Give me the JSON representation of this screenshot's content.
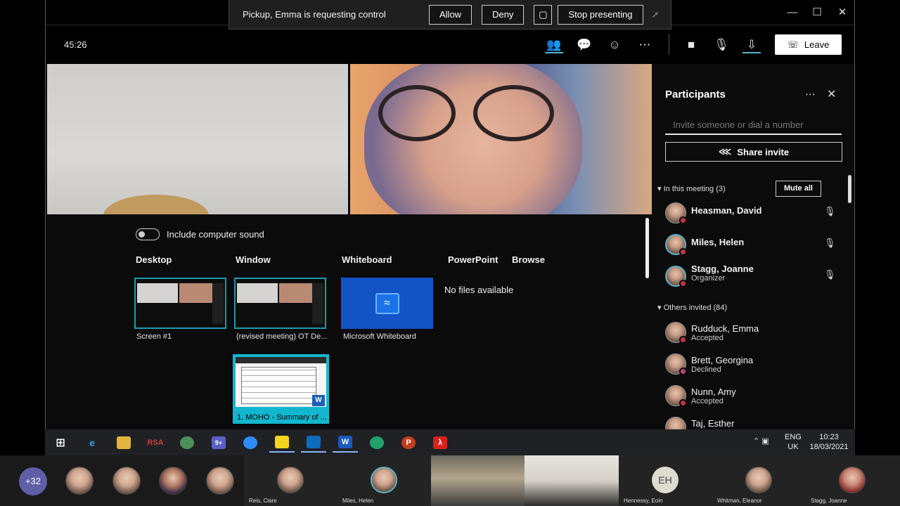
{
  "control_request": {
    "message": "Pickup, Emma is requesting control",
    "allow_label": "Allow",
    "deny_label": "Deny",
    "stop_presenting_label": "Stop presenting"
  },
  "meeting": {
    "timer": "45:26",
    "leave_label": "Leave"
  },
  "share_tray": {
    "include_sound_label": "Include computer sound",
    "categories": [
      "Desktop",
      "Window",
      "Whiteboard",
      "PowerPoint",
      "Browse"
    ],
    "desktop_thumb_caption": "Screen #1",
    "window_thumb_caption": "(revised meeting) OT De...",
    "whiteboard_caption": "Microsoft Whiteboard",
    "no_files_text": "No files available",
    "doc_thumb_caption": "1. MOHO - Summary of ..."
  },
  "participants": {
    "title": "Participants",
    "invite_placeholder": "Invite someone or dial a number",
    "share_invite_label": "Share invite",
    "in_meeting_label": "In this meeting (3)",
    "mute_all_label": "Mute all",
    "in_meeting": [
      {
        "name": "Heasman, David",
        "role": ""
      },
      {
        "name": "Miles, Helen",
        "role": ""
      },
      {
        "name": "Stagg, Joanne",
        "role": "Organizer"
      }
    ],
    "others_label": "Others invited (84)",
    "others": [
      {
        "name": "Rudduck, Emma",
        "status": "Accepted"
      },
      {
        "name": "Brett, Georgina",
        "status": "Declined"
      },
      {
        "name": "Nunn, Amy",
        "status": "Accepted"
      },
      {
        "name": "Taj, Esther",
        "status": ""
      }
    ]
  },
  "taskbar": {
    "rsa_label": "RSA",
    "teams_badge": "9+",
    "lang_line1": "ENG",
    "lang_line2": "UK",
    "time": "10:23",
    "date": "18/03/2021"
  },
  "gallery": {
    "overflow_count": "+32",
    "tiles": [
      {
        "name": "Reis, Clare"
      },
      {
        "name": "Miles, Helen"
      },
      {
        "name": "Hennessy, Eoin",
        "initials": "EH"
      },
      {
        "name": "Whitman, Eleanor"
      },
      {
        "name": "Stagg, Joanne"
      }
    ]
  },
  "colors": {
    "accent": "#5ab4c8",
    "whiteboard": "#1253c6",
    "presence_busy": "#c4314b",
    "overflow_avatar": "#5f5fa6"
  }
}
